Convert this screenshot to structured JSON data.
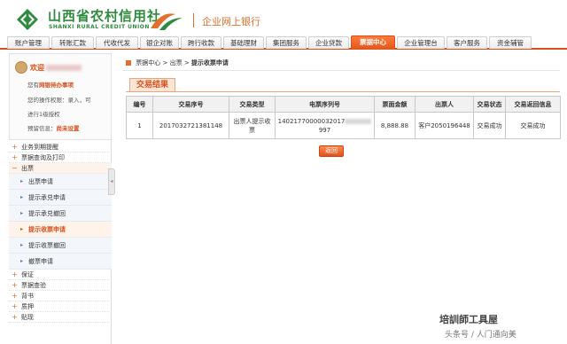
{
  "header": {
    "bank_name_cn": "山西省农村信用社",
    "bank_name_en": "SHANXI RURAL CREDIT UNION",
    "portal_title": "企业网上银行"
  },
  "nav": {
    "tabs": [
      {
        "label": "账户管理",
        "active": false
      },
      {
        "label": "转账汇款",
        "active": false
      },
      {
        "label": "代收代发",
        "active": false
      },
      {
        "label": "银企对账",
        "active": false
      },
      {
        "label": "跨行收款",
        "active": false
      },
      {
        "label": "基础理财",
        "active": false
      },
      {
        "label": "集团服务",
        "active": false
      },
      {
        "label": "企业贷款",
        "active": false
      },
      {
        "label": "票据中心",
        "active": true
      },
      {
        "label": "企业管理台",
        "active": false
      },
      {
        "label": "客户服务",
        "active": false
      },
      {
        "label": "资金辅管",
        "active": false
      }
    ]
  },
  "user": {
    "welcome": "欢迎",
    "line1": "您有",
    "line1_hl": "网银待办事项",
    "line2": "您的操作权限：录入，可",
    "line3": "进行1级授权",
    "line4_label": "预留信息：",
    "line4_value": "尚未设置"
  },
  "sidebar": {
    "top_items": [
      "业务到期提醒",
      "票据查询及打印"
    ],
    "open_section": "出票",
    "sub_items": [
      {
        "label": "出票申请",
        "current": false
      },
      {
        "label": "提示承兑申请",
        "current": false
      },
      {
        "label": "提示承兑撤回",
        "current": false
      },
      {
        "label": "提示收票申请",
        "current": true
      },
      {
        "label": "提示收票撤回",
        "current": false
      },
      {
        "label": "撤票申请",
        "current": false
      }
    ],
    "bottom_items": [
      "保证",
      "票据查验",
      "背书",
      "质押",
      "贴现"
    ]
  },
  "main": {
    "breadcrumb": [
      "票据中心",
      "出票",
      "提示收票申请"
    ],
    "breadcrumb_sep": ">",
    "result_tab": "交易结果",
    "table": {
      "headers": [
        "编号",
        "交易序号",
        "交易类型",
        "电票序列号",
        "票面金额",
        "出票人",
        "交易状态",
        "交易返回信息"
      ],
      "rows": [
        {
          "no": "1",
          "seq": "2017032721381148",
          "type": "出票人提示收票",
          "serial_prefix": "14021770000032017",
          "serial_suffix": "997",
          "amount": "8,888.88",
          "drawer": "客户2050196448",
          "status": "交易成功",
          "message": "交易成功"
        }
      ]
    },
    "back_button": "返回"
  },
  "watermark": {
    "line1": "培訓師工具屋",
    "line2": "头条号 / 人门通向美"
  },
  "colors": {
    "brand_green": "#2e8b3d",
    "accent_orange": "#e26f2c",
    "active_tab": "#e2551c"
  }
}
